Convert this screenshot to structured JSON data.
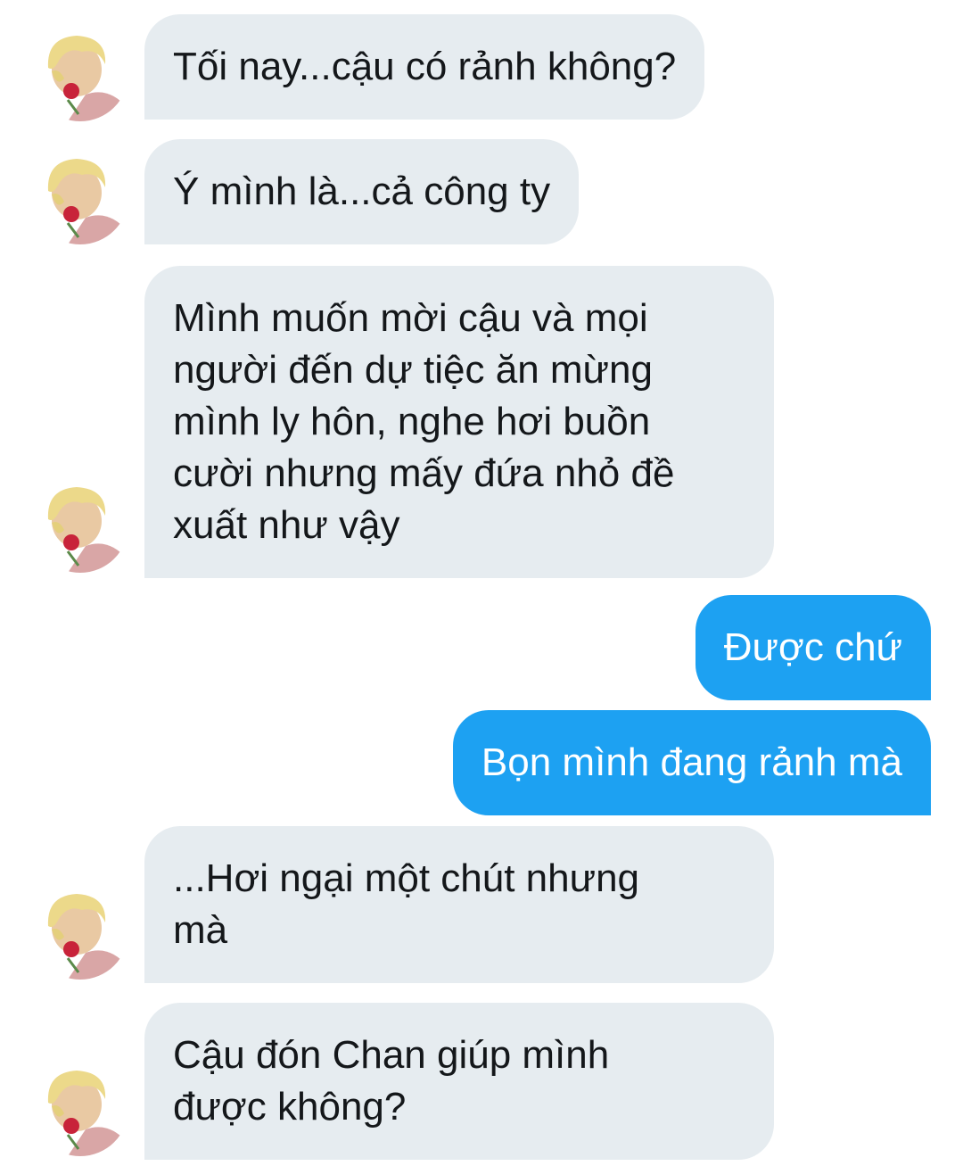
{
  "conversation": {
    "messages": [
      {
        "sender": "other",
        "text": "Tối nay...cậu có rảnh không?"
      },
      {
        "sender": "other",
        "text": "Ý mình là...cả công ty"
      },
      {
        "sender": "other",
        "text": "Mình muốn mời cậu và mọi\nngười đến dự tiệc ăn mừng\nmình ly hôn, nghe hơi buồn\ncười nhưng mấy đứa nhỏ đề\nxuất như vậy"
      },
      {
        "sender": "me",
        "text": "Được chứ"
      },
      {
        "sender": "me",
        "text": "Bọn mình đang rảnh mà"
      },
      {
        "sender": "other",
        "text": "...Hơi ngại một chút nhưng\nmà"
      },
      {
        "sender": "other",
        "text": "Cậu đón Chan giúp mình\nđược không?"
      }
    ]
  },
  "colors": {
    "incoming_bubble": "#e6ecf0",
    "outgoing_bubble": "#1da1f2",
    "incoming_text": "#14171a",
    "outgoing_text": "#ffffff"
  },
  "icons": {
    "avatar": "user-avatar-photo"
  }
}
